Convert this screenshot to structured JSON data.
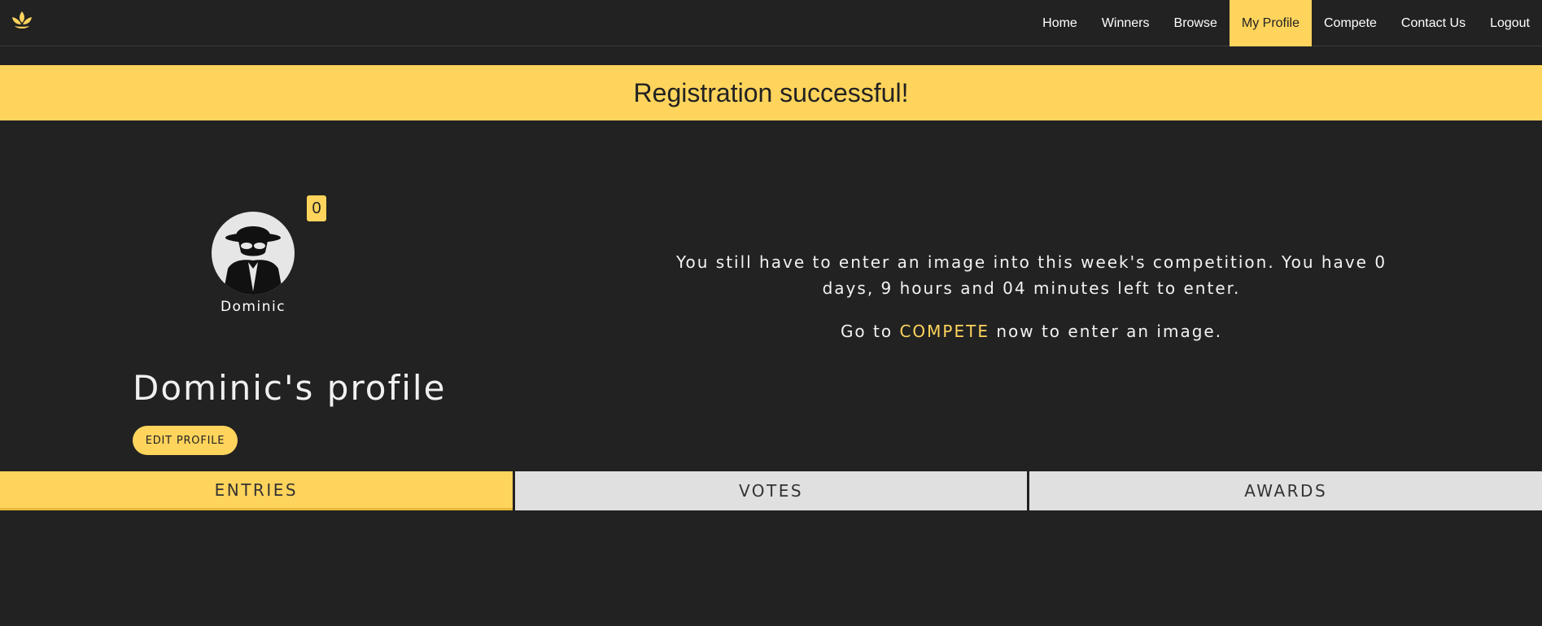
{
  "colors": {
    "accent": "#ffd45c",
    "background": "#222222",
    "tab_inactive": "#e0e0e0"
  },
  "navbar": {
    "logo_icon": "lotus-icon",
    "links": [
      {
        "label": "Home"
      },
      {
        "label": "Winners"
      },
      {
        "label": "Browse"
      },
      {
        "label": "My Profile",
        "active": true
      },
      {
        "label": "Compete"
      },
      {
        "label": "Contact Us"
      },
      {
        "label": "Logout"
      }
    ]
  },
  "banner": {
    "message": "Registration successful!"
  },
  "profile": {
    "avatar_icon": "spy-avatar-icon",
    "badge_count": "0",
    "username": "Dominic",
    "title": "Dominic's profile",
    "edit_label": "EDIT PROFILE"
  },
  "competition": {
    "notice": "You still have to enter an image into this week's competition. You have 0 days, 9 hours and 04 minutes left to enter.",
    "cta_prefix": "Go to ",
    "cta_link": "COMPETE",
    "cta_suffix": " now to enter an image."
  },
  "tabs": [
    {
      "label": "ENTRIES",
      "active": true
    },
    {
      "label": "VOTES"
    },
    {
      "label": "AWARDS"
    }
  ]
}
